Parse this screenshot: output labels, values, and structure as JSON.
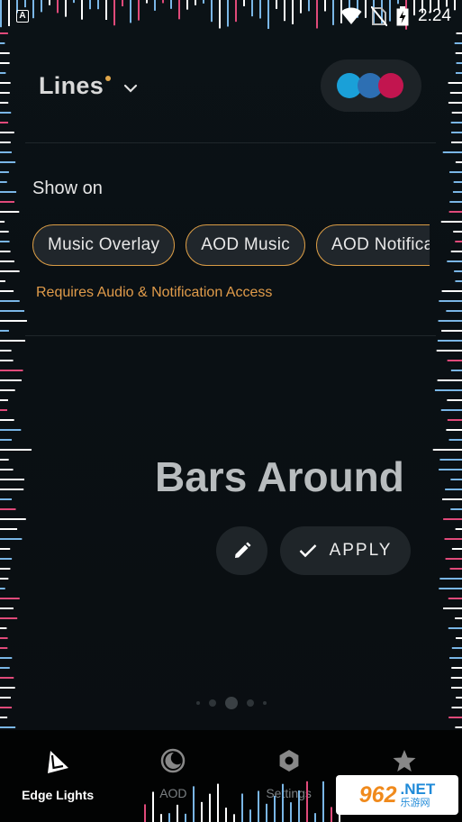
{
  "status_bar": {
    "time": "2:24"
  },
  "header": {
    "title": "Lines"
  },
  "palette": {
    "colors": [
      "#1aa0d8",
      "#2d6fb3",
      "#c2154f"
    ]
  },
  "show_on": {
    "label": "Show on",
    "chips": [
      "Music Overlay",
      "AOD Music",
      "AOD Notifications"
    ],
    "requires": "Requires Audio & Notification Access"
  },
  "effect": {
    "title": "Bars Around",
    "apply_label": "APPLY"
  },
  "nav": {
    "items": [
      {
        "label": "Edge Lights",
        "icon": "edge-lights-icon",
        "active": true
      },
      {
        "label": "AOD",
        "icon": "aod-moon-icon",
        "active": false
      },
      {
        "label": "Settings",
        "icon": "settings-hex-icon",
        "active": false
      },
      {
        "label": "",
        "icon": "star-icon",
        "active": false
      }
    ]
  },
  "watermark": {
    "brand": "962",
    "net": ".NET",
    "sub": "乐游网"
  },
  "colors": {
    "accent": "#d89b45",
    "chip_bg": "#20262b",
    "bar_blue": "#7ab6e6",
    "bar_pink": "#e04a7a"
  }
}
